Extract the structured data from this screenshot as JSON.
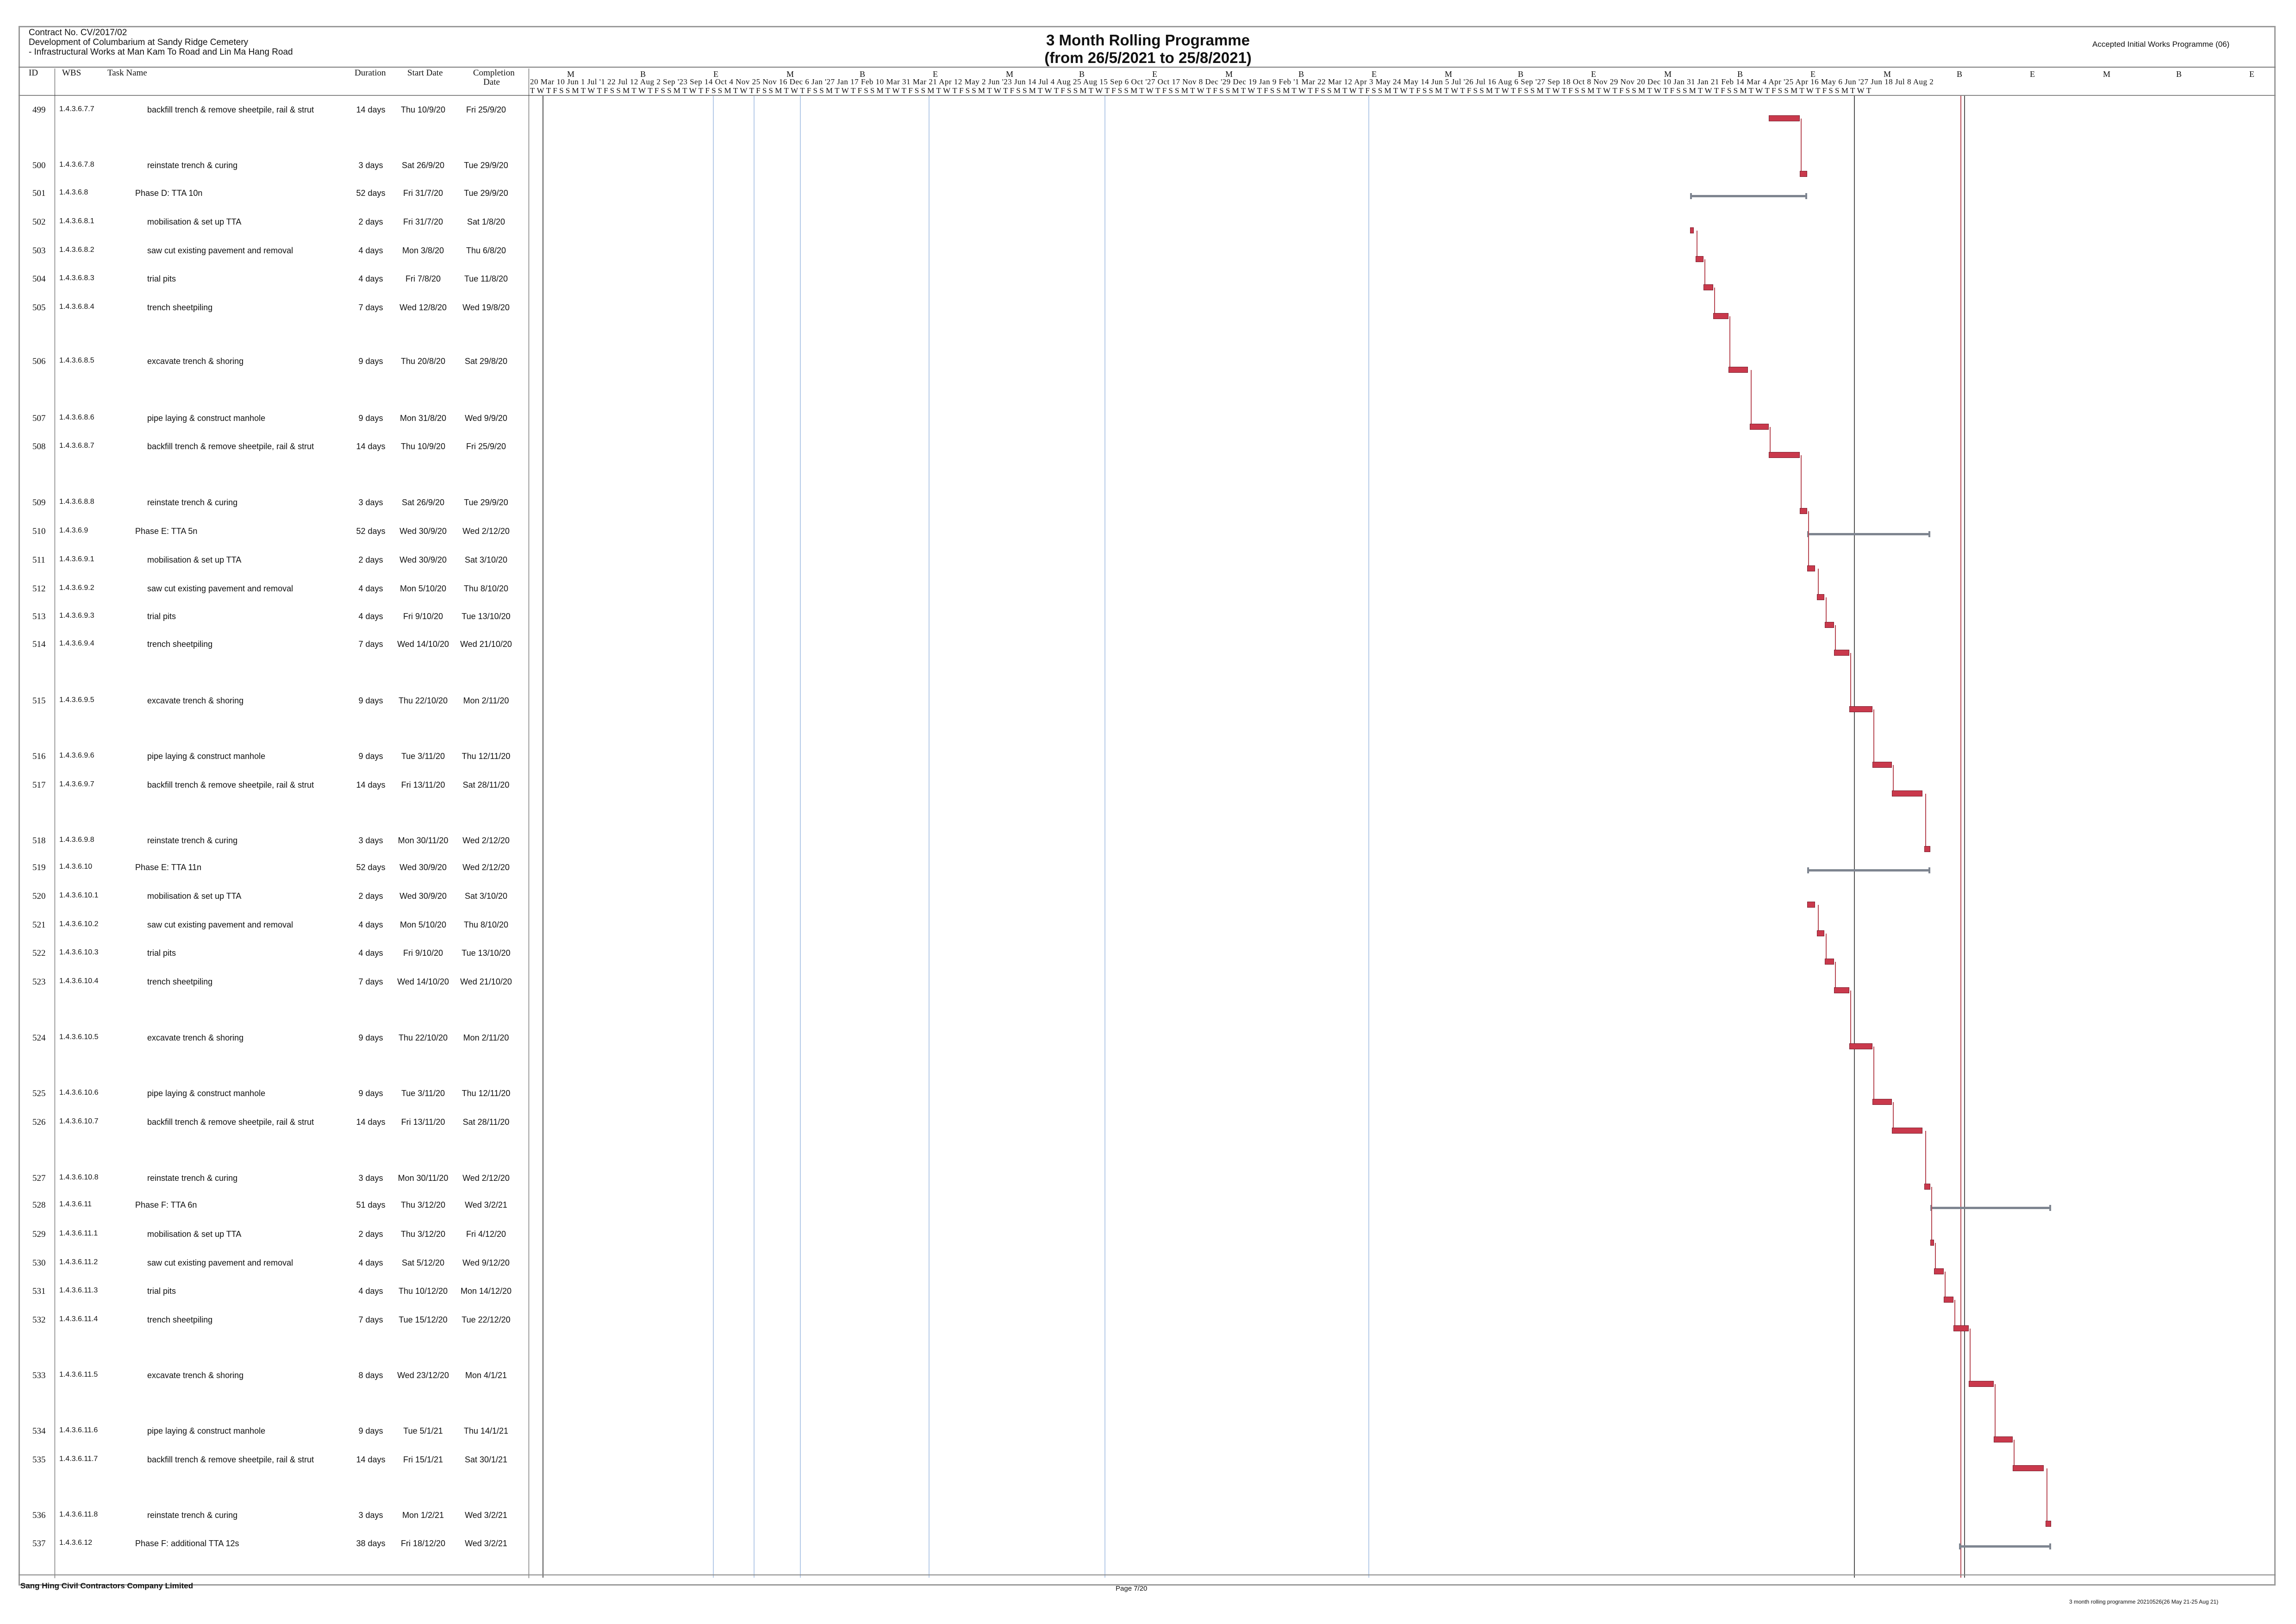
{
  "header": {
    "contract": "Contract No. CV/2017/02",
    "project": "Development of Columbarium at Sandy Ridge Cemetery",
    "subproject": "- Infrastructural Works at Man Kam To Road and Lin Ma Hang Road",
    "title": "3 Month Rolling Programme",
    "subtitle": "(from 26/5/2021 to 25/8/2021)",
    "status": "Accepted Initial Works Programme (06)"
  },
  "columns": {
    "id": "ID",
    "wbs": "WBS",
    "task": "Task Name",
    "duration": "Duration",
    "start": "Start Date",
    "completion": "Completion Date"
  },
  "timescale": {
    "months": [
      "M",
      "B",
      "E",
      "M",
      "B",
      "E",
      "M",
      "B",
      "E",
      "M",
      "B",
      "E",
      "M",
      "B",
      "E",
      "M",
      "B",
      "E",
      "M",
      "B",
      "E",
      "M",
      "B",
      "E"
    ],
    "dates": "20 Mar 10 Jun 1 Jul '1 22 Jul 12 Aug 2 Sep '23 Sep 14 Oct 4 Nov 25 Nov 16 Dec 6 Jan '27 Jan 17 Feb 10 Mar 31 Mar 21 Apr 12 May 2 Jun '23 Jun 14 Jul 4 Aug 25 Aug 15 Sep 6 Oct '27 Oct 17 Nov 8 Dec '29 Dec 19 Jan 9 Feb '1 Mar 22 Mar 12 Apr 3 May 24 May 14 Jun 5 Jul '26 Jul 16 Aug 6 Sep '27 Sep 18 Oct 8 Nov 29 Nov 20 Dec 10 Jan 31 Jan 21 Feb 14 Mar 4 Apr '25 Apr 16 May 6 Jun '27 Jun 18 Jul 8 Aug 2",
    "days": "TWTFSSMTWTFSSMTWTFSSMTWTFSSMTWTFSSMTWTFSSMTWTFSSMTWTFSSMTWTFSSMTWTFSSMTWTFSSMTWTFSSMTWTFSSMTWTFSSMTWTFSSMTWTFSSMTWTFSSMTWTFSSMTWTFSSMTWTFSSMTWTFSSMTWTFSSMTWTFSSMTWTFSSMTWTFSSMTWTFSSMTWT"
  },
  "tasks": [
    {
      "id": "499",
      "wbs": "1.4.3.6.7.7",
      "name": "backfill trench & remove sheetpile, rail & strut",
      "duration": "14 days",
      "start": "Thu 10/9/20",
      "end": "Fri 25/9/20",
      "indent": 2
    },
    {
      "id": "500",
      "wbs": "1.4.3.6.7.8",
      "name": "reinstate trench & curing",
      "duration": "3 days",
      "start": "Sat 26/9/20",
      "end": "Tue 29/9/20",
      "indent": 2
    },
    {
      "id": "501",
      "wbs": "1.4.3.6.8",
      "name": "Phase D: TTA 10n",
      "duration": "52 days",
      "start": "Fri 31/7/20",
      "end": "Tue 29/9/20",
      "indent": 1
    },
    {
      "id": "502",
      "wbs": "1.4.3.6.8.1",
      "name": "mobilisation & set up TTA",
      "duration": "2 days",
      "start": "Fri 31/7/20",
      "end": "Sat 1/8/20",
      "indent": 2
    },
    {
      "id": "503",
      "wbs": "1.4.3.6.8.2",
      "name": "saw cut existing pavement and removal",
      "duration": "4 days",
      "start": "Mon 3/8/20",
      "end": "Thu 6/8/20",
      "indent": 2
    },
    {
      "id": "504",
      "wbs": "1.4.3.6.8.3",
      "name": "trial pits",
      "duration": "4 days",
      "start": "Fri 7/8/20",
      "end": "Tue 11/8/20",
      "indent": 2
    },
    {
      "id": "505",
      "wbs": "1.4.3.6.8.4",
      "name": "trench sheetpiling",
      "duration": "7 days",
      "start": "Wed 12/8/20",
      "end": "Wed 19/8/20",
      "indent": 2
    },
    {
      "id": "506",
      "wbs": "1.4.3.6.8.5",
      "name": "excavate trench & shoring",
      "duration": "9 days",
      "start": "Thu 20/8/20",
      "end": "Sat 29/8/20",
      "indent": 2
    },
    {
      "id": "507",
      "wbs": "1.4.3.6.8.6",
      "name": "pipe laying & construct manhole",
      "duration": "9 days",
      "start": "Mon 31/8/20",
      "end": "Wed 9/9/20",
      "indent": 2
    },
    {
      "id": "508",
      "wbs": "1.4.3.6.8.7",
      "name": "backfill trench & remove sheetpile, rail & strut",
      "duration": "14 days",
      "start": "Thu 10/9/20",
      "end": "Fri 25/9/20",
      "indent": 2
    },
    {
      "id": "509",
      "wbs": "1.4.3.6.8.8",
      "name": "reinstate trench & curing",
      "duration": "3 days",
      "start": "Sat 26/9/20",
      "end": "Tue 29/9/20",
      "indent": 2
    },
    {
      "id": "510",
      "wbs": "1.4.3.6.9",
      "name": "Phase E: TTA 5n",
      "duration": "52 days",
      "start": "Wed 30/9/20",
      "end": "Wed 2/12/20",
      "indent": 1
    },
    {
      "id": "511",
      "wbs": "1.4.3.6.9.1",
      "name": "mobilisation & set up TTA",
      "duration": "2 days",
      "start": "Wed 30/9/20",
      "end": "Sat 3/10/20",
      "indent": 2
    },
    {
      "id": "512",
      "wbs": "1.4.3.6.9.2",
      "name": "saw cut existing pavement and removal",
      "duration": "4 days",
      "start": "Mon 5/10/20",
      "end": "Thu 8/10/20",
      "indent": 2
    },
    {
      "id": "513",
      "wbs": "1.4.3.6.9.3",
      "name": "trial pits",
      "duration": "4 days",
      "start": "Fri 9/10/20",
      "end": "Tue 13/10/20",
      "indent": 2
    },
    {
      "id": "514",
      "wbs": "1.4.3.6.9.4",
      "name": "trench sheetpiling",
      "duration": "7 days",
      "start": "Wed 14/10/20",
      "end": "Wed 21/10/20",
      "indent": 2
    },
    {
      "id": "515",
      "wbs": "1.4.3.6.9.5",
      "name": "excavate trench & shoring",
      "duration": "9 days",
      "start": "Thu 22/10/20",
      "end": "Mon 2/11/20",
      "indent": 2
    },
    {
      "id": "516",
      "wbs": "1.4.3.6.9.6",
      "name": "pipe laying & construct manhole",
      "duration": "9 days",
      "start": "Tue 3/11/20",
      "end": "Thu 12/11/20",
      "indent": 2
    },
    {
      "id": "517",
      "wbs": "1.4.3.6.9.7",
      "name": "backfill trench & remove sheetpile, rail & strut",
      "duration": "14 days",
      "start": "Fri 13/11/20",
      "end": "Sat 28/11/20",
      "indent": 2
    },
    {
      "id": "518",
      "wbs": "1.4.3.6.9.8",
      "name": "reinstate trench & curing",
      "duration": "3 days",
      "start": "Mon 30/11/20",
      "end": "Wed 2/12/20",
      "indent": 2
    },
    {
      "id": "519",
      "wbs": "1.4.3.6.10",
      "name": "Phase E: TTA 11n",
      "duration": "52 days",
      "start": "Wed 30/9/20",
      "end": "Wed 2/12/20",
      "indent": 1
    },
    {
      "id": "520",
      "wbs": "1.4.3.6.10.1",
      "name": "mobilisation & set up TTA",
      "duration": "2 days",
      "start": "Wed 30/9/20",
      "end": "Sat 3/10/20",
      "indent": 2
    },
    {
      "id": "521",
      "wbs": "1.4.3.6.10.2",
      "name": "saw cut existing pavement and removal",
      "duration": "4 days",
      "start": "Mon 5/10/20",
      "end": "Thu 8/10/20",
      "indent": 2
    },
    {
      "id": "522",
      "wbs": "1.4.3.6.10.3",
      "name": "trial pits",
      "duration": "4 days",
      "start": "Fri 9/10/20",
      "end": "Tue 13/10/20",
      "indent": 2
    },
    {
      "id": "523",
      "wbs": "1.4.3.6.10.4",
      "name": "trench sheetpiling",
      "duration": "7 days",
      "start": "Wed 14/10/20",
      "end": "Wed 21/10/20",
      "indent": 2
    },
    {
      "id": "524",
      "wbs": "1.4.3.6.10.5",
      "name": "excavate trench & shoring",
      "duration": "9 days",
      "start": "Thu 22/10/20",
      "end": "Mon 2/11/20",
      "indent": 2
    },
    {
      "id": "525",
      "wbs": "1.4.3.6.10.6",
      "name": "pipe laying & construct manhole",
      "duration": "9 days",
      "start": "Tue 3/11/20",
      "end": "Thu 12/11/20",
      "indent": 2
    },
    {
      "id": "526",
      "wbs": "1.4.3.6.10.7",
      "name": "backfill trench & remove sheetpile, rail & strut",
      "duration": "14 days",
      "start": "Fri 13/11/20",
      "end": "Sat 28/11/20",
      "indent": 2
    },
    {
      "id": "527",
      "wbs": "1.4.3.6.10.8",
      "name": "reinstate trench & curing",
      "duration": "3 days",
      "start": "Mon 30/11/20",
      "end": "Wed 2/12/20",
      "indent": 2
    },
    {
      "id": "528",
      "wbs": "1.4.3.6.11",
      "name": "Phase F: TTA 6n",
      "duration": "51 days",
      "start": "Thu 3/12/20",
      "end": "Wed 3/2/21",
      "indent": 1
    },
    {
      "id": "529",
      "wbs": "1.4.3.6.11.1",
      "name": "mobilisation & set up TTA",
      "duration": "2 days",
      "start": "Thu 3/12/20",
      "end": "Fri 4/12/20",
      "indent": 2
    },
    {
      "id": "530",
      "wbs": "1.4.3.6.11.2",
      "name": "saw cut existing pavement and removal",
      "duration": "4 days",
      "start": "Sat 5/12/20",
      "end": "Wed 9/12/20",
      "indent": 2
    },
    {
      "id": "531",
      "wbs": "1.4.3.6.11.3",
      "name": "trial pits",
      "duration": "4 days",
      "start": "Thu 10/12/20",
      "end": "Mon 14/12/20",
      "indent": 2
    },
    {
      "id": "532",
      "wbs": "1.4.3.6.11.4",
      "name": "trench sheetpiling",
      "duration": "7 days",
      "start": "Tue 15/12/20",
      "end": "Tue 22/12/20",
      "indent": 2
    },
    {
      "id": "533",
      "wbs": "1.4.3.6.11.5",
      "name": "excavate trench & shoring",
      "duration": "8 days",
      "start": "Wed 23/12/20",
      "end": "Mon 4/1/21",
      "indent": 2
    },
    {
      "id": "534",
      "wbs": "1.4.3.6.11.6",
      "name": "pipe laying & construct manhole",
      "duration": "9 days",
      "start": "Tue 5/1/21",
      "end": "Thu 14/1/21",
      "indent": 2
    },
    {
      "id": "535",
      "wbs": "1.4.3.6.11.7",
      "name": "backfill trench & remove sheetpile, rail & strut",
      "duration": "14 days",
      "start": "Fri 15/1/21",
      "end": "Sat 30/1/21",
      "indent": 2
    },
    {
      "id": "536",
      "wbs": "1.4.3.6.11.8",
      "name": "reinstate trench & curing",
      "duration": "3 days",
      "start": "Mon 1/2/21",
      "end": "Wed 3/2/21",
      "indent": 2
    },
    {
      "id": "537",
      "wbs": "1.4.3.6.12",
      "name": "Phase F: additional TTA 12s",
      "duration": "38 days",
      "start": "Fri 18/12/20",
      "end": "Wed 3/2/21",
      "indent": 1
    }
  ],
  "footer": {
    "company": "Sang Hing Civil Contractors Company Limited",
    "page": "Page 7/20",
    "file": "3 month rolling programme 20210526(26 May 21-25 Aug 21)"
  },
  "colors": {
    "task_bar": "#c9394c",
    "summary_bar": "#7e8590",
    "gridline": "#b6cbe8"
  }
}
